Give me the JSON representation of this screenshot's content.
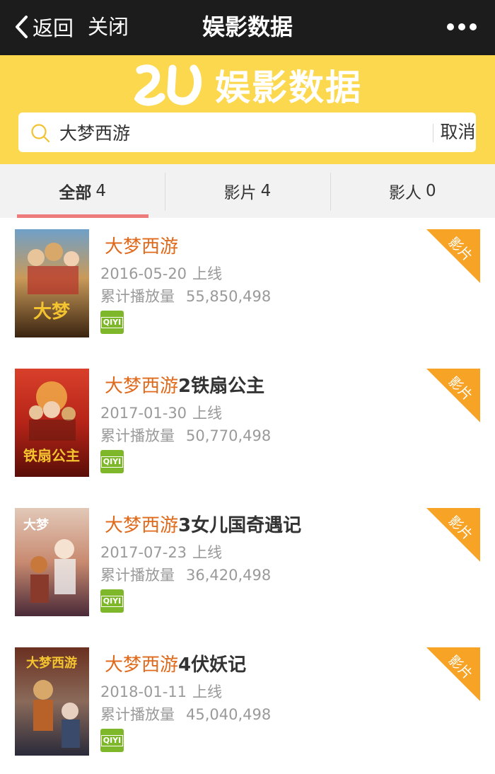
{
  "nav": {
    "back_label": "返回",
    "close_label": "关闭",
    "title": "娱影数据"
  },
  "brand": {
    "name": "娱影数据"
  },
  "search": {
    "value": "大梦西游",
    "cancel_label": "取消"
  },
  "tabs": [
    {
      "label": "全部",
      "count": "4",
      "active": true
    },
    {
      "label": "影片",
      "count": "4",
      "active": false
    },
    {
      "label": "影人",
      "count": "0",
      "active": false
    }
  ],
  "results": [
    {
      "title_highlight": "大梦西游",
      "title_rest": "",
      "date": "2016-05-20",
      "date_suffix": "上线",
      "plays_label": "累计播放量",
      "plays": "55,850,498",
      "platform": "QIYI",
      "tag": "影片"
    },
    {
      "title_highlight": "大梦西游",
      "title_rest": "2铁扇公主",
      "date": "2017-01-30",
      "date_suffix": "上线",
      "plays_label": "累计播放量",
      "plays": "50,770,498",
      "platform": "QIYI",
      "tag": "影片"
    },
    {
      "title_highlight": "大梦西游",
      "title_rest": "3女儿国奇遇记",
      "date": "2017-07-23",
      "date_suffix": "上线",
      "plays_label": "累计播放量",
      "plays": "36,420,498",
      "platform": "QIYI",
      "tag": "影片"
    },
    {
      "title_highlight": "大梦西游",
      "title_rest": "4伏妖记",
      "date": "2018-01-11",
      "date_suffix": "上线",
      "plays_label": "累计播放量",
      "plays": "45,040,498",
      "platform": "QIYI",
      "tag": "影片"
    }
  ],
  "colors": {
    "brand_yellow": "#fcd84e",
    "highlight_orange": "#e06a1c",
    "tag_orange": "#f7a326",
    "tab_indicator": "#ee7b7b",
    "platform_green": "#7eb82a"
  }
}
